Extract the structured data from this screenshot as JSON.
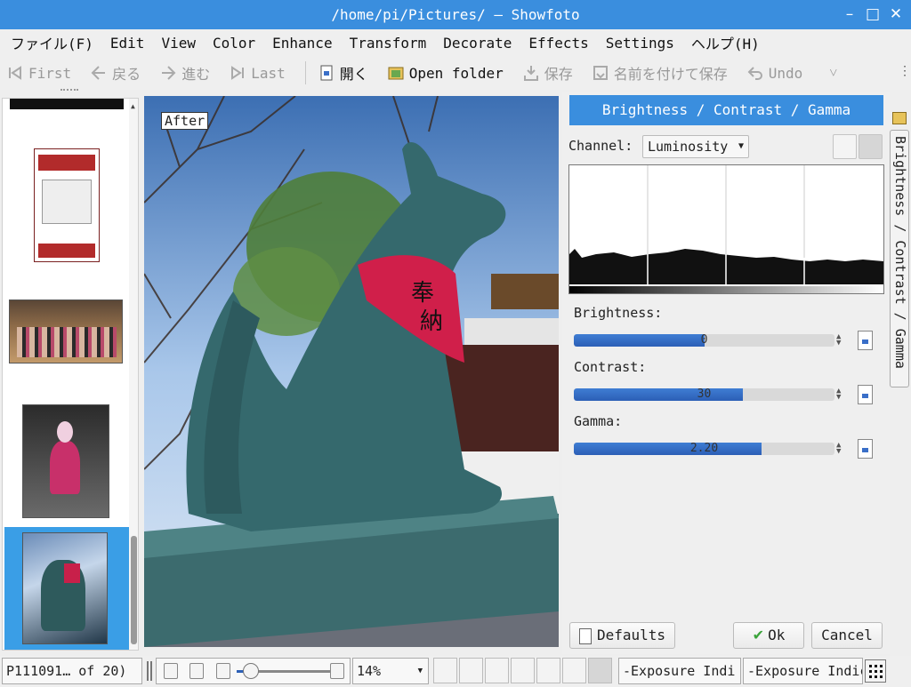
{
  "window": {
    "title": "/home/pi/Pictures/ — Showfoto",
    "controls": [
      "–",
      "□",
      "✕"
    ]
  },
  "menu": [
    "ファイル(F)",
    "Edit",
    "View",
    "Color",
    "Enhance",
    "Transform",
    "Decorate",
    "Effects",
    "Settings",
    "ヘルプ(H)"
  ],
  "toolbar": {
    "first": "First",
    "back": "戻る",
    "forward": "進む",
    "last": "Last",
    "open": "開く",
    "open_folder": "Open folder",
    "save": "保存",
    "save_as": "名前を付けて保存",
    "undo": "Undo",
    "more": "˅"
  },
  "canvas": {
    "after_label": "After"
  },
  "tool": {
    "title": "Brightness / Contrast / Gamma",
    "channel_label": "Channel:",
    "channel_value": "Luminosity",
    "brightness_label": "Brightness:",
    "brightness_value": "0",
    "brightness_fill": 0.5,
    "contrast_label": "Contrast:",
    "contrast_value": "30",
    "contrast_fill": 0.65,
    "gamma_label": "Gamma:",
    "gamma_value": "2.20",
    "gamma_fill": 0.72,
    "defaults_label": "Defaults",
    "ok_label": "Ok",
    "cancel_label": "Cancel",
    "side_tab": "Brightness / Contrast / Gamma"
  },
  "statusbar": {
    "file_info": "P111091… of 20)",
    "zoom": "14%",
    "exposure_1": "-Exposure Indi",
    "exposure_2": "-Exposure Indic"
  },
  "colors": {
    "accent": "#3a8ede",
    "slider": "#2c5fb6"
  }
}
